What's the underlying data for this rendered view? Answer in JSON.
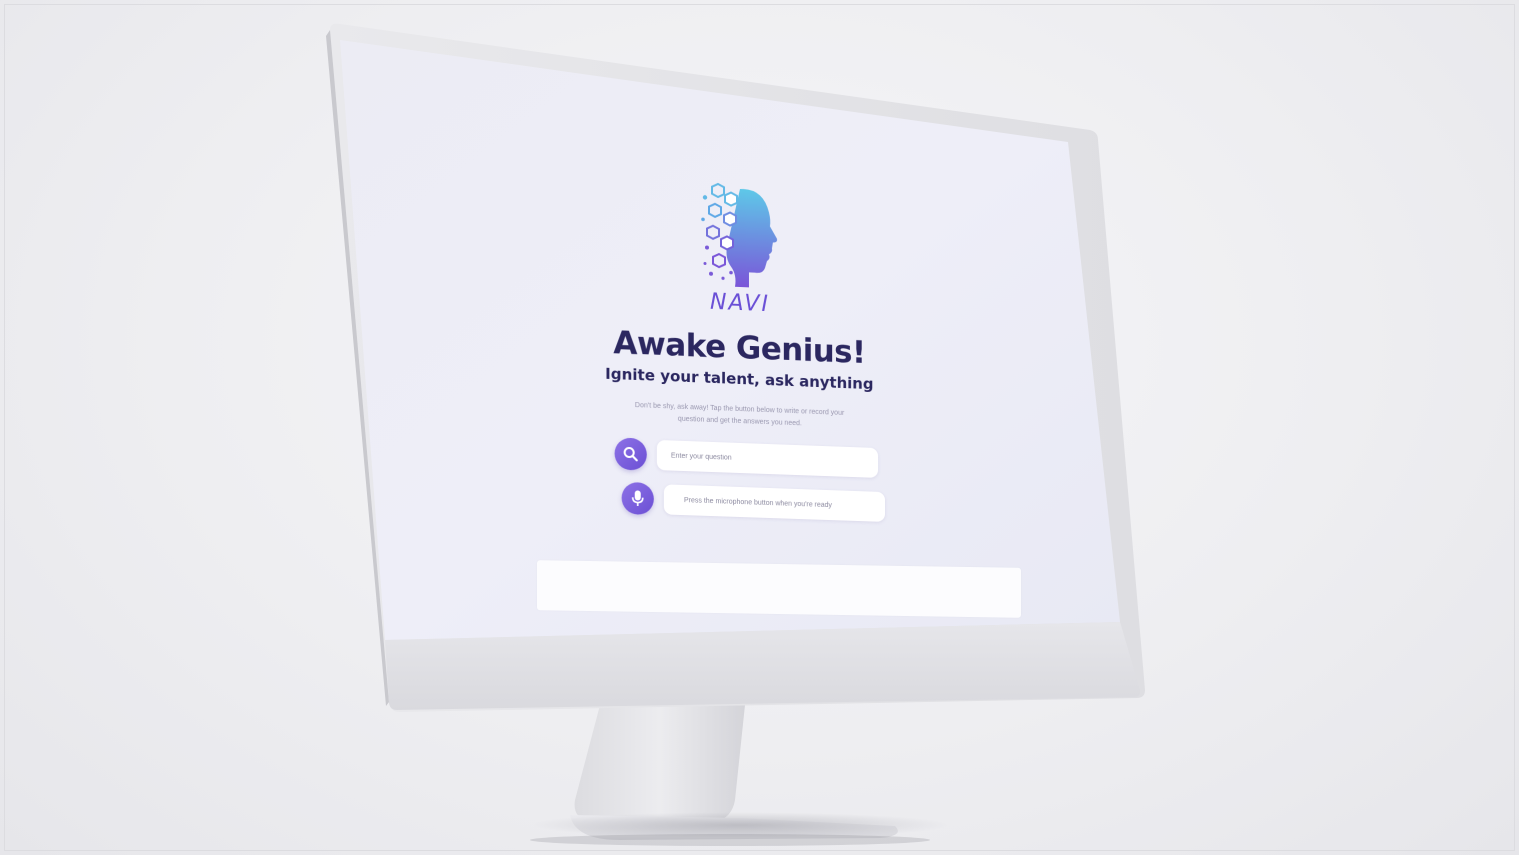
{
  "app": {
    "brand_name": "NAVI",
    "headline": "Awake Genius!",
    "subheadline": "Ignite your talent, ask anything",
    "description": "Don't be shy, ask away! Tap the button below to write or record your question and get the answers you need."
  },
  "search": {
    "icon": "search-icon",
    "placeholder": "Enter your question"
  },
  "voice": {
    "icon": "microphone-icon",
    "hint": "Press the microphone button when you're ready"
  },
  "colors": {
    "accent": "#6b4fd4",
    "accent_light": "#8d72e6",
    "heading": "#2b2760",
    "logo_cyan": "#5ec8e8",
    "screen_bg": "#eeeff8"
  }
}
